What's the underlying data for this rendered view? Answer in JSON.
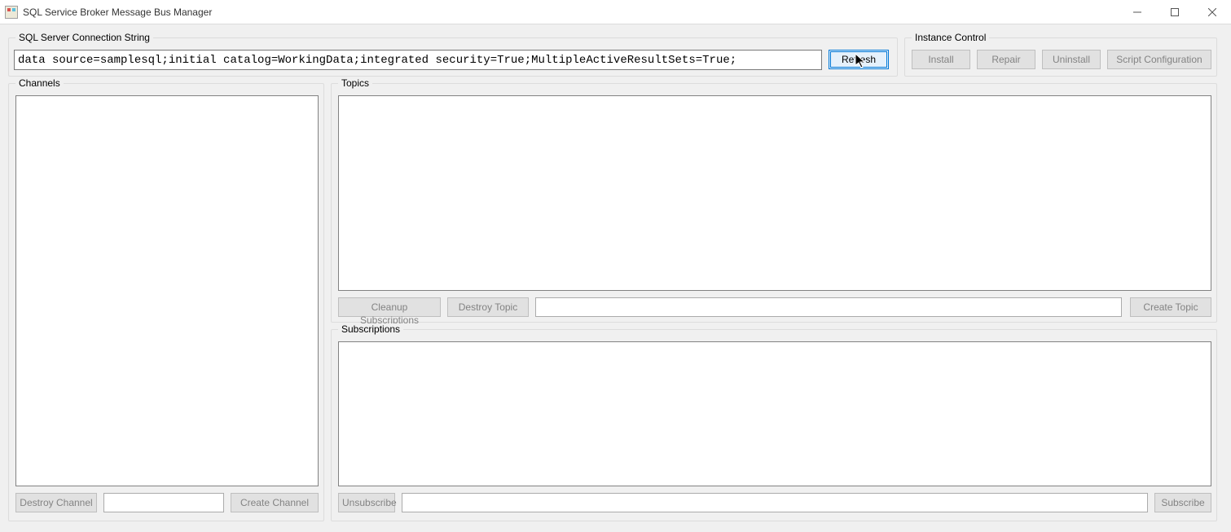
{
  "window": {
    "title": "SQL Service Broker Message Bus Manager"
  },
  "connection": {
    "group_label": "SQL Server Connection String",
    "value": "data source=samplesql;initial catalog=WorkingData;integrated security=True;MultipleActiveResultSets=True;",
    "refresh_label": "Refresh"
  },
  "instance_control": {
    "group_label": "Instance Control",
    "install_label": "Install",
    "repair_label": "Repair",
    "uninstall_label": "Uninstall",
    "script_config_label": "Script Configuration"
  },
  "channels": {
    "group_label": "Channels",
    "destroy_label": "Destroy Channel",
    "create_label": "Create Channel",
    "new_name_value": ""
  },
  "topics": {
    "group_label": "Topics",
    "cleanup_label": "Cleanup Subscriptions",
    "destroy_label": "Destroy Topic",
    "create_label": "Create Topic",
    "new_name_value": ""
  },
  "subscriptions": {
    "group_label": "Subscriptions",
    "unsubscribe_label": "Unsubscribe",
    "subscribe_label": "Subscribe",
    "new_name_value": ""
  }
}
